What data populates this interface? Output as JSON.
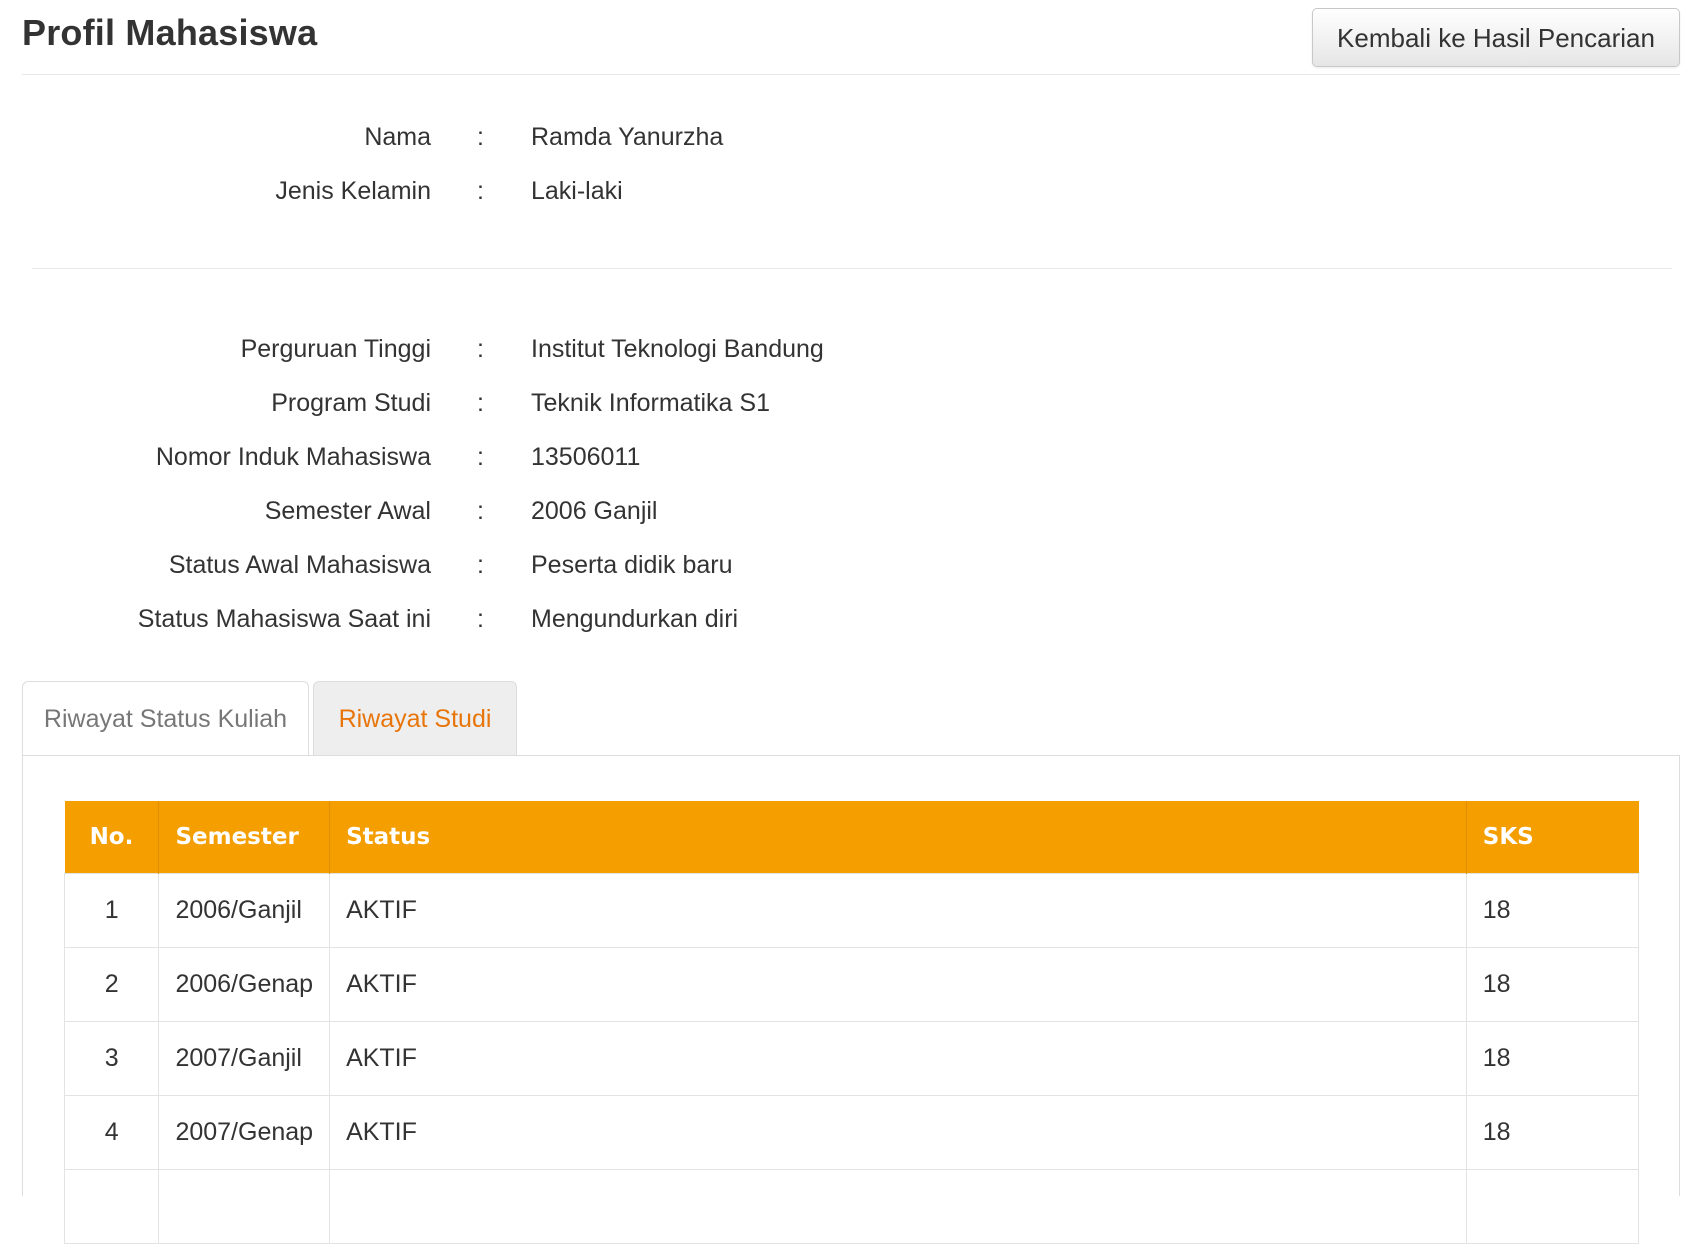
{
  "header": {
    "title": "Profil Mahasiswa",
    "back_button_label": "Kembali ke Hasil Pencarian"
  },
  "personal": {
    "rows": [
      {
        "label": "Nama",
        "value": "Ramda Yanurzha"
      },
      {
        "label": "Jenis Kelamin",
        "value": "Laki-laki"
      }
    ]
  },
  "academic": {
    "rows": [
      {
        "label": "Perguruan Tinggi",
        "value": "Institut Teknologi Bandung"
      },
      {
        "label": "Program Studi",
        "value": "Teknik Informatika S1"
      },
      {
        "label": "Nomor Induk Mahasiswa",
        "value": "13506011"
      },
      {
        "label": "Semester Awal",
        "value": "2006 Ganjil"
      },
      {
        "label": "Status Awal Mahasiswa",
        "value": "Peserta didik baru"
      },
      {
        "label": "Status Mahasiswa Saat ini",
        "value": "Mengundurkan diri"
      }
    ]
  },
  "separator": ":",
  "tabs": [
    {
      "label": "Riwayat Status Kuliah",
      "active": true
    },
    {
      "label": "Riwayat Studi",
      "active": false
    }
  ],
  "table": {
    "headers": [
      "No.",
      "Semester",
      "Status",
      "SKS"
    ],
    "rows": [
      {
        "no": "1",
        "semester": "2006/Ganjil",
        "status": "AKTIF",
        "sks": "18"
      },
      {
        "no": "2",
        "semester": "2006/Genap",
        "status": "AKTIF",
        "sks": "18"
      },
      {
        "no": "3",
        "semester": "2007/Ganjil",
        "status": "AKTIF",
        "sks": "18"
      },
      {
        "no": "4",
        "semester": "2007/Genap",
        "status": "AKTIF",
        "sks": "18"
      },
      {
        "no": "",
        "semester": "",
        "status": "",
        "sks": ""
      }
    ],
    "header_color": "#f59e00"
  },
  "colors": {
    "accent": "#f59e00",
    "tab_active_text": "#e8750a"
  }
}
